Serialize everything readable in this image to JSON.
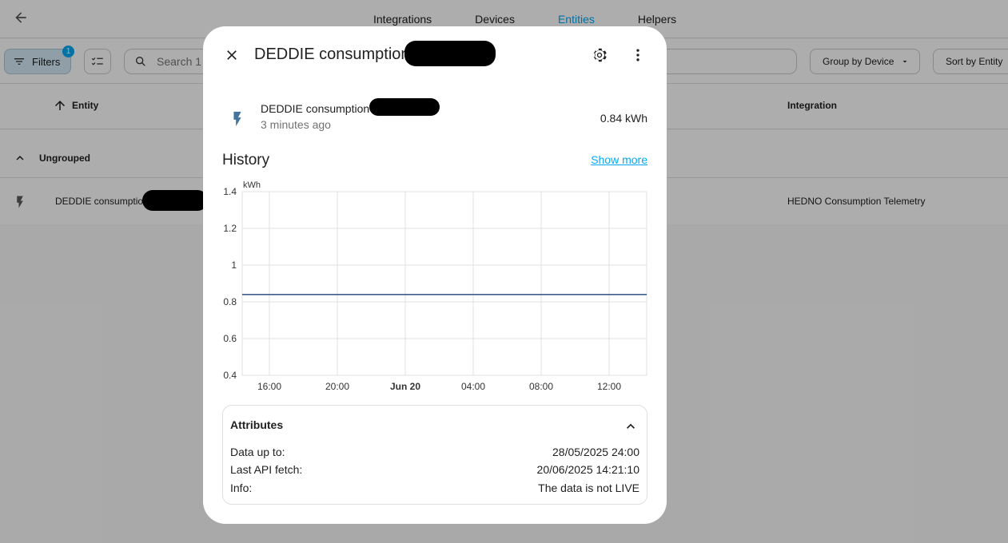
{
  "nav": {
    "tabs": [
      {
        "label": "Integrations",
        "active": false
      },
      {
        "label": "Devices",
        "active": false
      },
      {
        "label": "Entities",
        "active": true
      },
      {
        "label": "Helpers",
        "active": false
      }
    ],
    "accent_color": "#03a9f4"
  },
  "toolbar": {
    "filters_label": "Filters",
    "filters_count": "1",
    "search_placeholder": "Search 1 entity",
    "group_by_label": "Group by Device",
    "sort_label": "Sort by Entity"
  },
  "table": {
    "col_entity": "Entity",
    "col_integration": "Integration",
    "group_label": "Ungrouped",
    "rows": [
      {
        "name": "DEDDIE consumption",
        "integration": "HEDNO Consumption Telemetry",
        "icon": "flash-icon"
      }
    ]
  },
  "dialog": {
    "title": "DEDDIE consumption",
    "state": {
      "name": "DEDDIE consumption",
      "last_changed": "3 minutes ago",
      "value": "0.84 kWh"
    },
    "history_title": "History",
    "show_more": "Show more",
    "attributes_title": "Attributes",
    "attributes": [
      {
        "key": "Data up to:",
        "value": "28/05/2025 24:00"
      },
      {
        "key": "Last API fetch:",
        "value": "20/06/2025 14:21:10"
      },
      {
        "key": "Info:",
        "value": "The data is not LIVE"
      }
    ]
  },
  "chart_data": {
    "type": "line",
    "ylabel": "kWh",
    "ylim": [
      0.4,
      1.4
    ],
    "yticks": [
      "1.4",
      "1.2",
      "1",
      "0.8",
      "0.6",
      "0.4"
    ],
    "xticks": [
      "16:00",
      "20:00",
      "Jun 20",
      "04:00",
      "08:00",
      "12:00"
    ],
    "series": [
      {
        "values": [
          0.84,
          0.84
        ],
        "color": "#3f5e8c"
      }
    ],
    "grid": true
  }
}
